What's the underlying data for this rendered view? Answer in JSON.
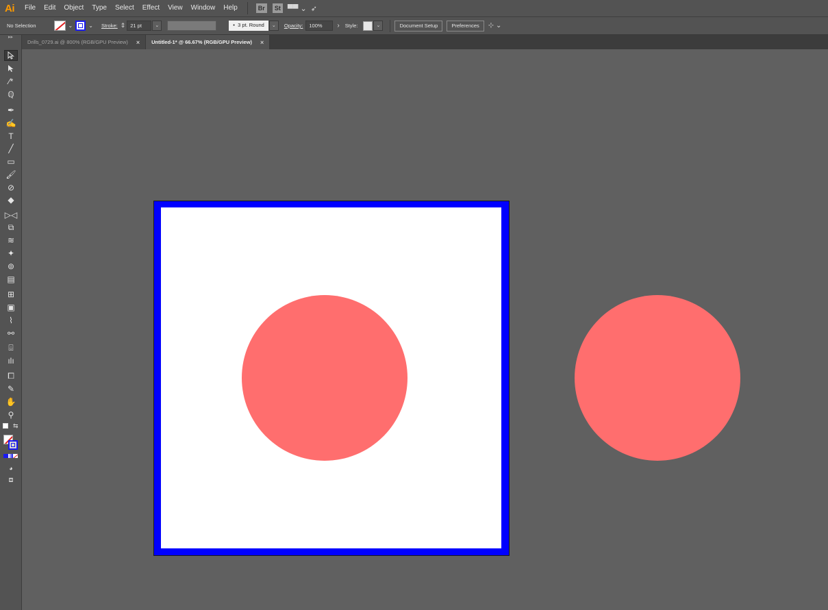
{
  "app": {
    "logo": "Ai"
  },
  "menu": [
    "File",
    "Edit",
    "Object",
    "Type",
    "Select",
    "Effect",
    "View",
    "Window",
    "Help"
  ],
  "menu_badges": {
    "bridge": "Br",
    "stock": "St"
  },
  "control": {
    "selection": "No Selection",
    "stroke_label": "Stroke:",
    "stroke_weight": "21 pt",
    "brush": "3 pt. Round",
    "brush_dot": "•",
    "opacity_label": "Opacity:",
    "opacity_value": "100%",
    "style_label": "Style:",
    "doc_setup": "Document Setup",
    "preferences": "Preferences"
  },
  "tabs": [
    {
      "label": "Drills_0729.ai @ 800% (RGB/GPU Preview)",
      "active": false
    },
    {
      "label": "Untitled-1* @ 66.67% (RGB/GPU Preview)",
      "active": true
    }
  ],
  "artwork": {
    "artboard_fill": "#ffffff",
    "artboard_stroke": "#0000ff",
    "circle_fill": "#ff6e6e",
    "canvas_bg": "#606060"
  }
}
